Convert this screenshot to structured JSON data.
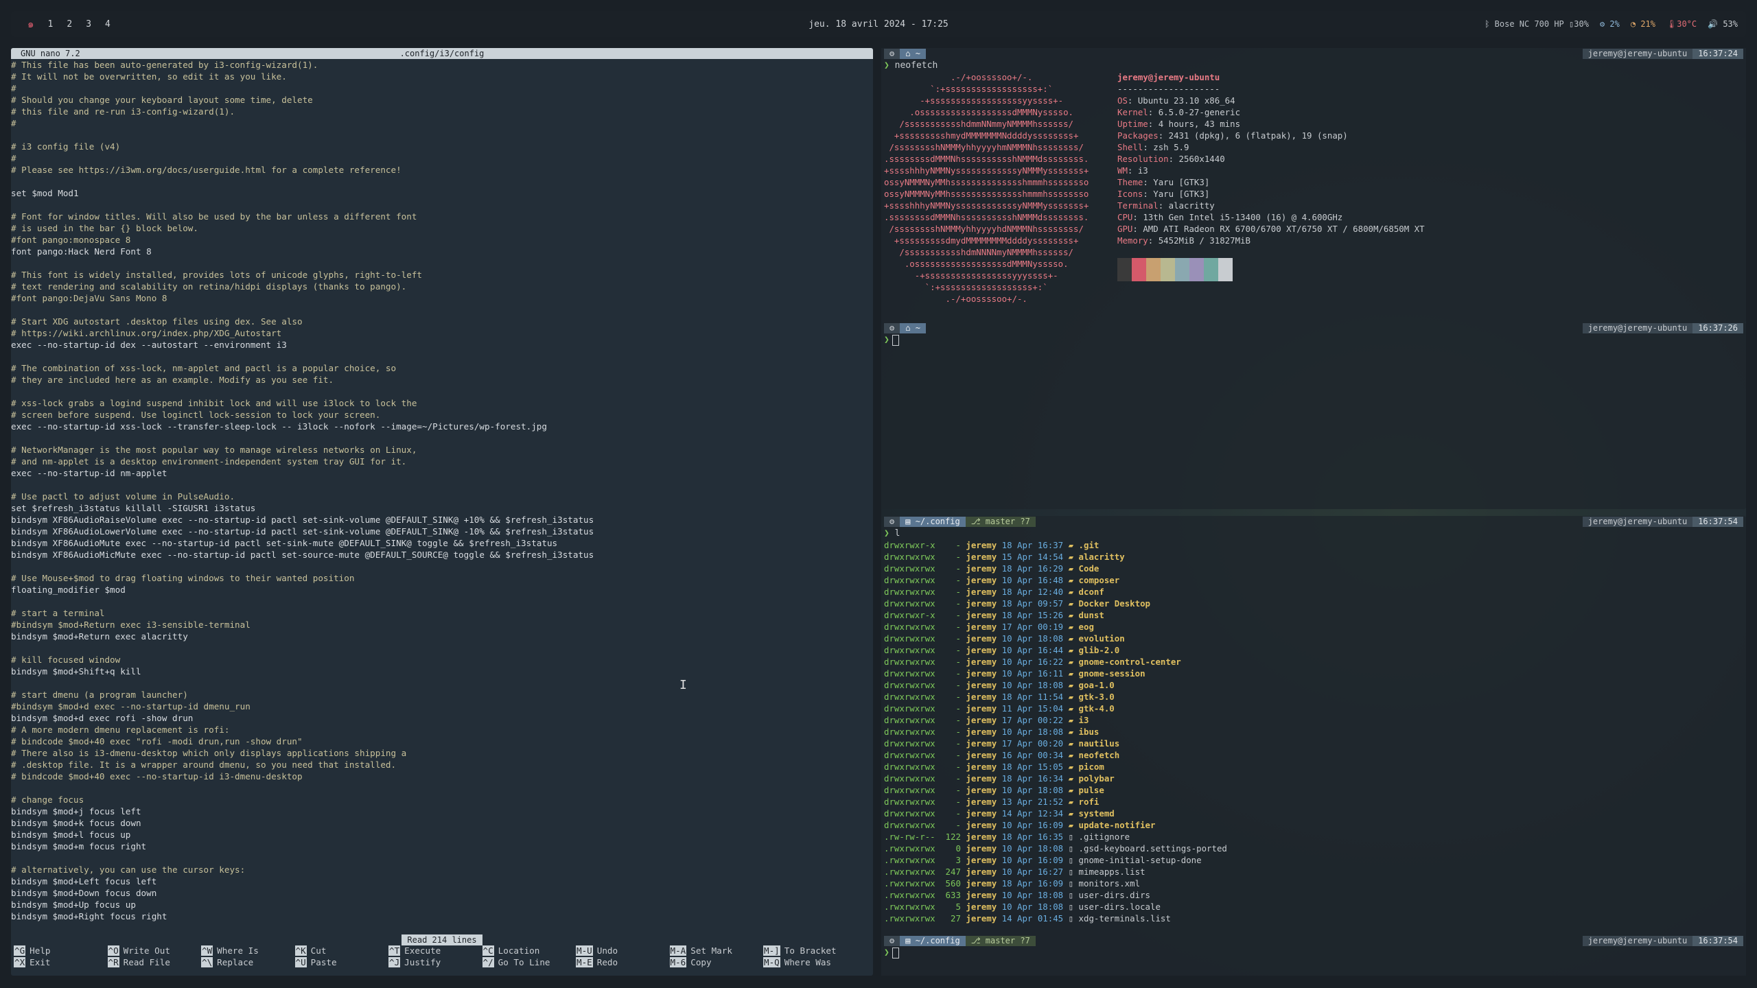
{
  "topbar": {
    "logo_icon": "debian-swirl-icon",
    "workspaces": [
      "1",
      "2",
      "3",
      "4"
    ],
    "clock": "jeu. 18 avril 2024 - 17:25",
    "bluetooth": "Bose NC 700 HP",
    "battery_bt": "30%",
    "cpu": "2%",
    "ram": "21%",
    "temp": "30°C",
    "volume": "53%"
  },
  "nano": {
    "version": "GNU nano 7.2",
    "filename": ".config/i3/config",
    "status": "Read 214 lines",
    "lines": [
      "# This file has been auto-generated by i3-config-wizard(1).",
      "# It will not be overwritten, so edit it as you like.",
      "#",
      "# Should you change your keyboard layout some time, delete",
      "# this file and re-run i3-config-wizard(1).",
      "#",
      "",
      "# i3 config file (v4)",
      "#",
      "# Please see https://i3wm.org/docs/userguide.html for a complete reference!",
      "",
      "set $mod Mod1",
      "",
      "# Font for window titles. Will also be used by the bar unless a different font",
      "# is used in the bar {} block below.",
      "#font pango:monospace 8",
      "font pango:Hack Nerd Font 8",
      "",
      "# This font is widely installed, provides lots of unicode glyphs, right-to-left",
      "# text rendering and scalability on retina/hidpi displays (thanks to pango).",
      "#font pango:DejaVu Sans Mono 8",
      "",
      "# Start XDG autostart .desktop files using dex. See also",
      "# https://wiki.archlinux.org/index.php/XDG_Autostart",
      "exec --no-startup-id dex --autostart --environment i3",
      "",
      "# The combination of xss-lock, nm-applet and pactl is a popular choice, so",
      "# they are included here as an example. Modify as you see fit.",
      "",
      "# xss-lock grabs a logind suspend inhibit lock and will use i3lock to lock the",
      "# screen before suspend. Use loginctl lock-session to lock your screen.",
      "exec --no-startup-id xss-lock --transfer-sleep-lock -- i3lock --nofork --image=~/Pictures/wp-forest.jpg",
      "",
      "# NetworkManager is the most popular way to manage wireless networks on Linux,",
      "# and nm-applet is a desktop environment-independent system tray GUI for it.",
      "exec --no-startup-id nm-applet",
      "",
      "# Use pactl to adjust volume in PulseAudio.",
      "set $refresh_i3status killall -SIGUSR1 i3status",
      "bindsym XF86AudioRaiseVolume exec --no-startup-id pactl set-sink-volume @DEFAULT_SINK@ +10% && $refresh_i3status",
      "bindsym XF86AudioLowerVolume exec --no-startup-id pactl set-sink-volume @DEFAULT_SINK@ -10% && $refresh_i3status",
      "bindsym XF86AudioMute exec --no-startup-id pactl set-sink-mute @DEFAULT_SINK@ toggle && $refresh_i3status",
      "bindsym XF86AudioMicMute exec --no-startup-id pactl set-source-mute @DEFAULT_SOURCE@ toggle && $refresh_i3status",
      "",
      "# Use Mouse+$mod to drag floating windows to their wanted position",
      "floating_modifier $mod",
      "",
      "# start a terminal",
      "#bindsym $mod+Return exec i3-sensible-terminal",
      "bindsym $mod+Return exec alacritty",
      "",
      "# kill focused window",
      "bindsym $mod+Shift+q kill",
      "",
      "# start dmenu (a program launcher)",
      "#bindsym $mod+d exec --no-startup-id dmenu_run",
      "bindsym $mod+d exec rofi -show drun",
      "# A more modern dmenu replacement is rofi:",
      "# bindcode $mod+40 exec \"rofi -modi drun,run -show drun\"",
      "# There also is i3-dmenu-desktop which only displays applications shipping a",
      "# .desktop file. It is a wrapper around dmenu, so you need that installed.",
      "# bindcode $mod+40 exec --no-startup-id i3-dmenu-desktop",
      "",
      "# change focus",
      "bindsym $mod+j focus left",
      "bindsym $mod+k focus down",
      "bindsym $mod+l focus up",
      "bindsym $mod+m focus right",
      "",
      "# alternatively, you can use the cursor keys:",
      "bindsym $mod+Left focus left",
      "bindsym $mod+Down focus down",
      "bindsym $mod+Up focus up",
      "bindsym $mod+Right focus right"
    ],
    "shortcuts": [
      {
        "k1": "^G",
        "l1": "Help",
        "k2": "^X",
        "l2": "Exit"
      },
      {
        "k1": "^O",
        "l1": "Write Out",
        "k2": "^R",
        "l2": "Read File"
      },
      {
        "k1": "^W",
        "l1": "Where Is",
        "k2": "^\\",
        "l2": "Replace"
      },
      {
        "k1": "^K",
        "l1": "Cut",
        "k2": "^U",
        "l2": "Paste"
      },
      {
        "k1": "^T",
        "l1": "Execute",
        "k2": "^J",
        "l2": "Justify"
      },
      {
        "k1": "^C",
        "l1": "Location",
        "k2": "^/",
        "l2": "Go To Line"
      },
      {
        "k1": "M-U",
        "l1": "Undo",
        "k2": "M-E",
        "l2": "Redo"
      },
      {
        "k1": "M-A",
        "l1": "Set Mark",
        "k2": "M-6",
        "l2": "Copy"
      },
      {
        "k1": "M-]",
        "l1": "To Bracket",
        "k2": "M-Q",
        "l2": "Where Was"
      }
    ]
  },
  "term1": {
    "dir": "~",
    "user": "jeremy@jeremy-ubuntu",
    "time": "16:37:24",
    "cmd": "neofetch",
    "art": [
      "             .-/+oossssoo+/-.",
      "         `:+ssssssssssssssssss+:`",
      "       -+ssssssssssssssssssyyssss+-",
      "     .ossssssssssssssssssdMMMNysssso.",
      "   /ssssssssssshdmmNNmmyNMMMMhssssss/",
      "  +ssssssssshmydMMMMMMMNddddyssssssss+",
      " /sssssssshNMMMyhhyyyyhmNMMMNhssssssss/",
      ".ssssssssdMMMNhsssssssssshNMMMdssssssss.",
      "+sssshhhyNMMNyssssssssssssyNMMMysssssss+",
      "ossyNMMMNyMMhsssssssssssssshmmmhssssssso",
      "ossyNMMMNyMMhsssssssssssssshmmmhssssssso",
      "+sssshhhyNMMNyssssssssssssyNMMMysssssss+",
      ".ssssssssdMMMNhsssssssssshNMMMdssssssss.",
      " /sssssssshNMMMyhhyyyyhdNMMMNhssssssss/",
      "  +sssssssssdmydMMMMMMMMddddyssssssss+",
      "   /ssssssssssshdmNNNNmyNMMMMhssssss/",
      "    .ossssssssssssssssssdMMMNysssso.",
      "      -+sssssssssssssssssyyyssss+-",
      "        `:+ssssssssssssssssss+:`",
      "            .-/+oossssoo+/-."
    ],
    "title": "jeremy@jeremy-ubuntu",
    "separator": "--------------------",
    "info": [
      {
        "k": "OS",
        "v": "Ubuntu 23.10 x86_64"
      },
      {
        "k": "Kernel",
        "v": "6.5.0-27-generic"
      },
      {
        "k": "Uptime",
        "v": "4 hours, 43 mins"
      },
      {
        "k": "Packages",
        "v": "2431 (dpkg), 6 (flatpak), 19 (snap)"
      },
      {
        "k": "Shell",
        "v": "zsh 5.9"
      },
      {
        "k": "Resolution",
        "v": "2560x1440"
      },
      {
        "k": "WM",
        "v": "i3"
      },
      {
        "k": "Theme",
        "v": "Yaru [GTK3]"
      },
      {
        "k": "Icons",
        "v": "Yaru [GTK3]"
      },
      {
        "k": "Terminal",
        "v": "alacritty"
      },
      {
        "k": "CPU",
        "v": "13th Gen Intel i5-13400 (16) @ 4.600GHz"
      },
      {
        "k": "GPU",
        "v": "AMD ATI Radeon RX 6700/6700 XT/6750 XT / 6800M/6850M XT"
      },
      {
        "k": "Memory",
        "v": "5452MiB / 31827MiB"
      }
    ],
    "palette": [
      "#3a3a3a",
      "#d45a6a",
      "#c8a070",
      "#b8b890",
      "#8aa8b0",
      "#9a90b8",
      "#70a8a0",
      "#c8ccd0"
    ]
  },
  "term2": {
    "dir": "~",
    "user": "jeremy@jeremy-ubuntu",
    "time": "16:37:26"
  },
  "term3": {
    "dir": "~/.config",
    "git": "master ?7",
    "user": "jeremy@jeremy-ubuntu",
    "time": "16:37:54",
    "cmd": "l",
    "entries": [
      {
        "p": "drwxrwxr-x",
        "s": "-",
        "d": "18 Apr 16:37",
        "n": ".git",
        "t": "dir"
      },
      {
        "p": "drwxrwxrwx",
        "s": "-",
        "d": "15 Apr 14:54",
        "n": "alacritty",
        "t": "dir"
      },
      {
        "p": "drwxrwxrwx",
        "s": "-",
        "d": "18 Apr 16:29",
        "n": "Code",
        "t": "dir"
      },
      {
        "p": "drwxrwxrwx",
        "s": "-",
        "d": "10 Apr 16:48",
        "n": "composer",
        "t": "dir"
      },
      {
        "p": "drwxrwxrwx",
        "s": "-",
        "d": "18 Apr 12:40",
        "n": "dconf",
        "t": "dir"
      },
      {
        "p": "drwxrwxrwx",
        "s": "-",
        "d": "18 Apr 09:57",
        "n": "Docker Desktop",
        "t": "dir"
      },
      {
        "p": "drwxrwxr-x",
        "s": "-",
        "d": "18 Apr 15:26",
        "n": "dunst",
        "t": "dir"
      },
      {
        "p": "drwxrwxrwx",
        "s": "-",
        "d": "17 Apr 00:19",
        "n": "eog",
        "t": "dir"
      },
      {
        "p": "drwxrwxrwx",
        "s": "-",
        "d": "10 Apr 18:08",
        "n": "evolution",
        "t": "dir"
      },
      {
        "p": "drwxrwxrwx",
        "s": "-",
        "d": "10 Apr 16:44",
        "n": "glib-2.0",
        "t": "dir"
      },
      {
        "p": "drwxrwxrwx",
        "s": "-",
        "d": "10 Apr 16:22",
        "n": "gnome-control-center",
        "t": "dir"
      },
      {
        "p": "drwxrwxrwx",
        "s": "-",
        "d": "10 Apr 16:11",
        "n": "gnome-session",
        "t": "dir"
      },
      {
        "p": "drwxrwxrwx",
        "s": "-",
        "d": "10 Apr 18:08",
        "n": "goa-1.0",
        "t": "dir"
      },
      {
        "p": "drwxrwxrwx",
        "s": "-",
        "d": "18 Apr 11:54",
        "n": "gtk-3.0",
        "t": "dir"
      },
      {
        "p": "drwxrwxrwx",
        "s": "-",
        "d": "11 Apr 15:04",
        "n": "gtk-4.0",
        "t": "dir"
      },
      {
        "p": "drwxrwxrwx",
        "s": "-",
        "d": "17 Apr 00:22",
        "n": "i3",
        "t": "dir"
      },
      {
        "p": "drwxrwxrwx",
        "s": "-",
        "d": "10 Apr 18:08",
        "n": "ibus",
        "t": "dir"
      },
      {
        "p": "drwxrwxrwx",
        "s": "-",
        "d": "17 Apr 00:20",
        "n": "nautilus",
        "t": "dir"
      },
      {
        "p": "drwxrwxrwx",
        "s": "-",
        "d": "16 Apr 00:34",
        "n": "neofetch",
        "t": "dir"
      },
      {
        "p": "drwxrwxrwx",
        "s": "-",
        "d": "18 Apr 15:05",
        "n": "picom",
        "t": "dir"
      },
      {
        "p": "drwxrwxrwx",
        "s": "-",
        "d": "18 Apr 16:34",
        "n": "polybar",
        "t": "dir"
      },
      {
        "p": "drwxrwxrwx",
        "s": "-",
        "d": "10 Apr 18:08",
        "n": "pulse",
        "t": "dir"
      },
      {
        "p": "drwxrwxrwx",
        "s": "-",
        "d": "13 Apr 21:52",
        "n": "rofi",
        "t": "dir"
      },
      {
        "p": "drwxrwxrwx",
        "s": "-",
        "d": "14 Apr 12:34",
        "n": "systemd",
        "t": "dir"
      },
      {
        "p": "drwxrwxrwx",
        "s": "-",
        "d": "10 Apr 16:09",
        "n": "update-notifier",
        "t": "dir"
      },
      {
        "p": ".rw-rw-r--",
        "s": "122",
        "d": "18 Apr 16:35",
        "n": ".gitignore",
        "t": "file"
      },
      {
        "p": ".rwxrwxrwx",
        "s": "0",
        "d": "10 Apr 18:08",
        "n": ".gsd-keyboard.settings-ported",
        "t": "file"
      },
      {
        "p": ".rwxrwxrwx",
        "s": "3",
        "d": "10 Apr 16:09",
        "n": "gnome-initial-setup-done",
        "t": "file"
      },
      {
        "p": ".rwxrwxrwx",
        "s": "247",
        "d": "10 Apr 16:27",
        "n": "mimeapps.list",
        "t": "file"
      },
      {
        "p": ".rwxrwxrwx",
        "s": "560",
        "d": "18 Apr 16:09",
        "n": "monitors.xml",
        "t": "file"
      },
      {
        "p": ".rwxrwxrwx",
        "s": "633",
        "d": "10 Apr 18:08",
        "n": "user-dirs.dirs",
        "t": "file"
      },
      {
        "p": ".rwxrwxrwx",
        "s": "5",
        "d": "10 Apr 18:08",
        "n": "user-dirs.locale",
        "t": "file"
      },
      {
        "p": ".rwxrwxrwx",
        "s": "27",
        "d": "14 Apr 01:45",
        "n": "xdg-terminals.list",
        "t": "file"
      }
    ],
    "owner": "jeremy"
  },
  "term4": {
    "dir": "~/.config",
    "git": "master ?7",
    "user": "jeremy@jeremy-ubuntu",
    "time": "16:37:54"
  }
}
